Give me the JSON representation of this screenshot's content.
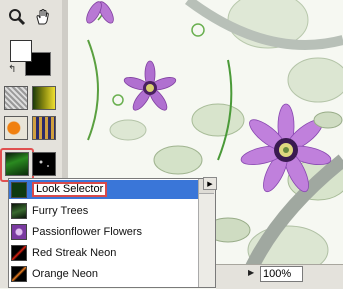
{
  "toolbox": {
    "tools": [
      {
        "name": "zoom-tool",
        "icon": "magnifier-icon"
      },
      {
        "name": "hand-tool",
        "icon": "hand-icon"
      }
    ],
    "colors": {
      "foreground": "#ffffff",
      "background": "#000000"
    }
  },
  "looks": {
    "items": [
      {
        "label": "Look Selector",
        "selected": true,
        "thumb": "#0e3a10"
      },
      {
        "label": "Furry Trees",
        "selected": false,
        "thumb": "#122a12"
      },
      {
        "label": "Passionflower Flowers",
        "selected": false,
        "thumb": "#6a2a8a"
      },
      {
        "label": "Red Streak Neon",
        "selected": false,
        "thumb": "#1a0505"
      },
      {
        "label": "Orange Neon",
        "selected": false,
        "thumb": "#2a1205"
      }
    ]
  },
  "statusbar": {
    "zoom": "100%"
  },
  "accent": {
    "selection": "#3a76d8",
    "highlight_border": "#d84a4a"
  }
}
